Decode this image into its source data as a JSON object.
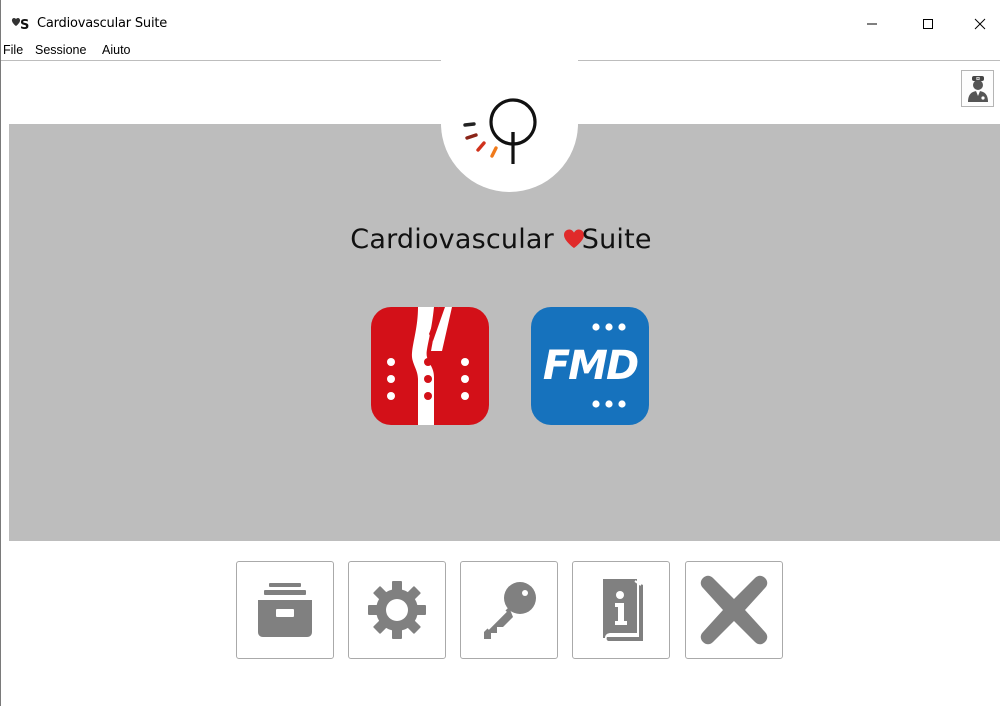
{
  "window": {
    "title": "Cardiovascular Suite",
    "app_icon": "heart-s-logo-icon"
  },
  "menu": {
    "items": [
      "File",
      "Sessione",
      "Aiuto"
    ]
  },
  "header": {
    "app_name_part1": "Cardiovascular",
    "app_name_part2": "Suite",
    "logo": "cardiovascular-suite-logo"
  },
  "apps": [
    {
      "name": "carotid-app",
      "icon": "carotid-artery-icon",
      "color": "#d31018"
    },
    {
      "name": "fmd-app",
      "label": "FMD",
      "icon": "fmd-icon",
      "color": "#1672bd"
    }
  ],
  "toolbar": [
    {
      "name": "archive-button",
      "icon": "archive-drawer-icon"
    },
    {
      "name": "settings-button",
      "icon": "gear-icon"
    },
    {
      "name": "license-button",
      "icon": "key-icon"
    },
    {
      "name": "manual-button",
      "icon": "info-book-icon"
    },
    {
      "name": "exit-button",
      "icon": "close-x-icon"
    }
  ],
  "colors": {
    "band": "#bdbdbd",
    "tool_gray": "#808080",
    "heart_red": "#e02a2a"
  }
}
